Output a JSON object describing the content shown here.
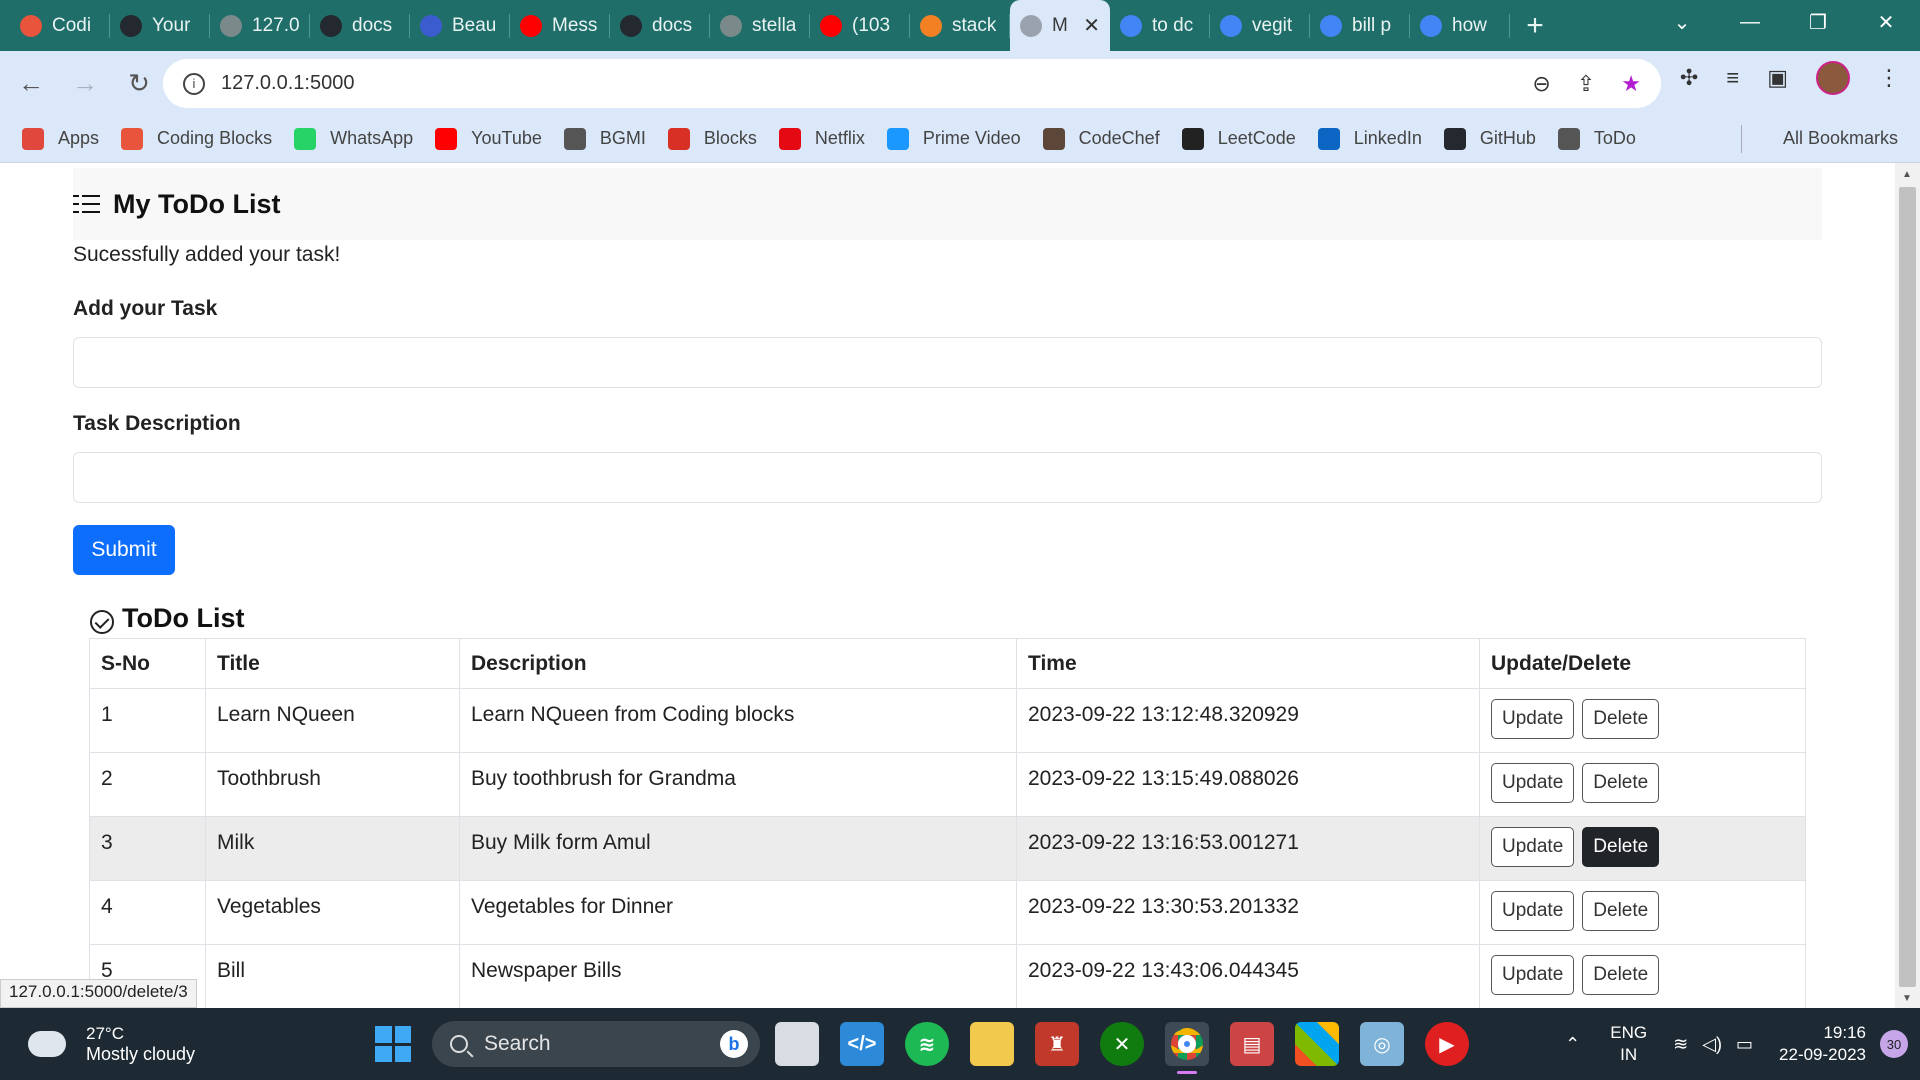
{
  "browser": {
    "tabs": [
      {
        "label": "Codi",
        "icon": "coding-blocks-icon",
        "color": "#e8543c"
      },
      {
        "label": "Your",
        "icon": "github-icon",
        "color": "#24292f"
      },
      {
        "label": "127.0",
        "icon": "globe-icon",
        "color": "#7a8a8a"
      },
      {
        "label": "docs",
        "icon": "github-icon",
        "color": "#24292f"
      },
      {
        "label": "Beau",
        "icon": "fx-icon",
        "color": "#3b5ccf"
      },
      {
        "label": "Mess",
        "icon": "youtube-icon",
        "color": "#ff0000"
      },
      {
        "label": "docs",
        "icon": "github-icon",
        "color": "#24292f"
      },
      {
        "label": "stella",
        "icon": "globe-icon",
        "color": "#7a8a8a"
      },
      {
        "label": "(103",
        "icon": "youtube-icon",
        "color": "#ff0000"
      },
      {
        "label": "stack",
        "icon": "stackoverflow-icon",
        "color": "#f48024"
      },
      {
        "label": "M",
        "icon": "globe-icon",
        "color": "#9aa3ad",
        "active": true
      },
      {
        "label": "to dc",
        "icon": "google-icon",
        "color": "#4285f4"
      },
      {
        "label": "vegit",
        "icon": "google-icon",
        "color": "#4285f4"
      },
      {
        "label": "bill p",
        "icon": "google-icon",
        "color": "#4285f4"
      },
      {
        "label": "how",
        "icon": "google-icon",
        "color": "#4285f4"
      }
    ],
    "url": "127.0.0.1:5000",
    "bookmarks": [
      {
        "label": "Apps",
        "icon": "apps-grid-icon",
        "color": "#e0483d"
      },
      {
        "label": "Coding Blocks",
        "icon": "coding-blocks-icon",
        "color": "#e8543c"
      },
      {
        "label": "WhatsApp",
        "icon": "whatsapp-icon",
        "color": "#25d366"
      },
      {
        "label": "YouTube",
        "icon": "youtube-icon",
        "color": "#ff0000"
      },
      {
        "label": "BGMI",
        "icon": "globe-icon",
        "color": "#555"
      },
      {
        "label": "Blocks",
        "icon": "gmail-icon",
        "color": "#d93025"
      },
      {
        "label": "Netflix",
        "icon": "netflix-icon",
        "color": "#e50914"
      },
      {
        "label": "Prime Video",
        "icon": "prime-video-icon",
        "color": "#1a98ff"
      },
      {
        "label": "CodeChef",
        "icon": "codechef-icon",
        "color": "#5b4638"
      },
      {
        "label": "LeetCode",
        "icon": "leetcode-icon",
        "color": "#222"
      },
      {
        "label": "LinkedIn",
        "icon": "linkedin-icon",
        "color": "#0a66c2"
      },
      {
        "label": "GitHub",
        "icon": "github-icon",
        "color": "#24292f"
      },
      {
        "label": "ToDo",
        "icon": "globe-icon",
        "color": "#555"
      }
    ],
    "all_bookmarks": "All Bookmarks",
    "status_url": "127.0.0.1:5000/delete/3"
  },
  "page": {
    "title": "My ToDo List",
    "flash": "Sucessfully added your task!",
    "task_label": "Add your Task",
    "task_value": "",
    "desc_label": "Task Description",
    "desc_value": "",
    "submit": "Submit",
    "list_title": "ToDo List",
    "columns": [
      "S-No",
      "Title",
      "Description",
      "Time",
      "Update/Delete"
    ],
    "rows": [
      {
        "sno": "1",
        "title": "Learn NQueen",
        "desc": "Learn NQueen from Coding blocks",
        "time": "2023-09-22 13:12:48.320929"
      },
      {
        "sno": "2",
        "title": "Toothbrush",
        "desc": "Buy toothbrush for Grandma",
        "time": "2023-09-22 13:15:49.088026"
      },
      {
        "sno": "3",
        "title": "Milk",
        "desc": "Buy Milk form Amul",
        "time": "2023-09-22 13:16:53.001271"
      },
      {
        "sno": "4",
        "title": "Vegetables",
        "desc": "Vegetables for Dinner",
        "time": "2023-09-22 13:30:53.201332"
      },
      {
        "sno": "5",
        "title": "Bill",
        "desc": "Newspaper Bills",
        "time": "2023-09-22 13:43:06.044345"
      }
    ],
    "update_label": "Update",
    "delete_label": "Delete"
  },
  "taskbar": {
    "temp": "27°C",
    "weather": "Mostly cloudy",
    "search": "Search",
    "lang1": "ENG",
    "lang2": "IN",
    "time": "19:16",
    "date": "22-09-2023",
    "notifications": "30"
  }
}
